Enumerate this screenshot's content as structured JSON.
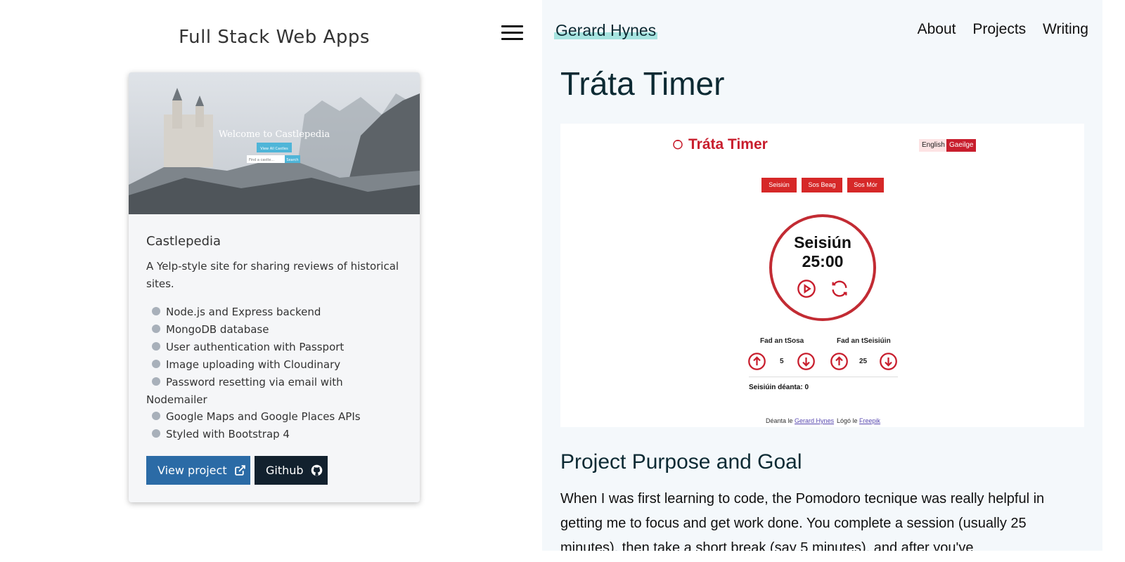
{
  "left": {
    "title": "Full Stack Web Apps",
    "menu_icon": "hamburger-menu-icon",
    "card": {
      "image_caption": "Welcome to Castlepedia",
      "image_button": "View All Castles",
      "image_search_placeholder": "Find a castle...",
      "image_search_button": "Search",
      "title": "Castlepedia",
      "description": "A Yelp-style site for sharing reviews of historical sites.",
      "features": [
        "Node.js and Express backend",
        "MongoDB database",
        "User authentication with Passport",
        "Image uploading with Cloudinary",
        "Password resetting via email with Nodemailer",
        "Google Maps and Google Places APIs",
        "Styled with Bootstrap 4"
      ],
      "view_button": "View project",
      "github_button": "Github"
    }
  },
  "right": {
    "brand": "Gerard Hynes",
    "nav": [
      "About",
      "Projects",
      "Writing"
    ],
    "page_title": "Tráta Timer",
    "screenshot": {
      "app_title": "Tráta Timer",
      "lang_english": "English",
      "lang_irish": "Gaeilge",
      "tabs": [
        "Seisiún",
        "Sos Beag",
        "Sos Mór"
      ],
      "session_label": "Seisiún",
      "time": "25:00",
      "break_length_label": "Fad an tSosa",
      "break_length_value": "5",
      "session_length_label": "Fad an tSeisiúin",
      "session_length_value": "25",
      "sessions_done": "Seisiúin déanta: 0",
      "footer_made_by": "Déanta le",
      "footer_author": "Gerard Hynes",
      "footer_logo_by": "Lógó le",
      "footer_logo_author": "Freepik"
    },
    "section_title": "Project Purpose and Goal",
    "paragraph": "When I was first learning to code, the Pomodoro tecnique was really helpful in getting me to focus and get work done. You complete a session (usually 25 minutes), then take a short break (say 5 minutes), and after you've"
  },
  "colors": {
    "primary_button": "#2b6ba6",
    "dark_button": "#12212e",
    "brand_highlight": "#a7e4e0",
    "app_red": "#d62828"
  }
}
